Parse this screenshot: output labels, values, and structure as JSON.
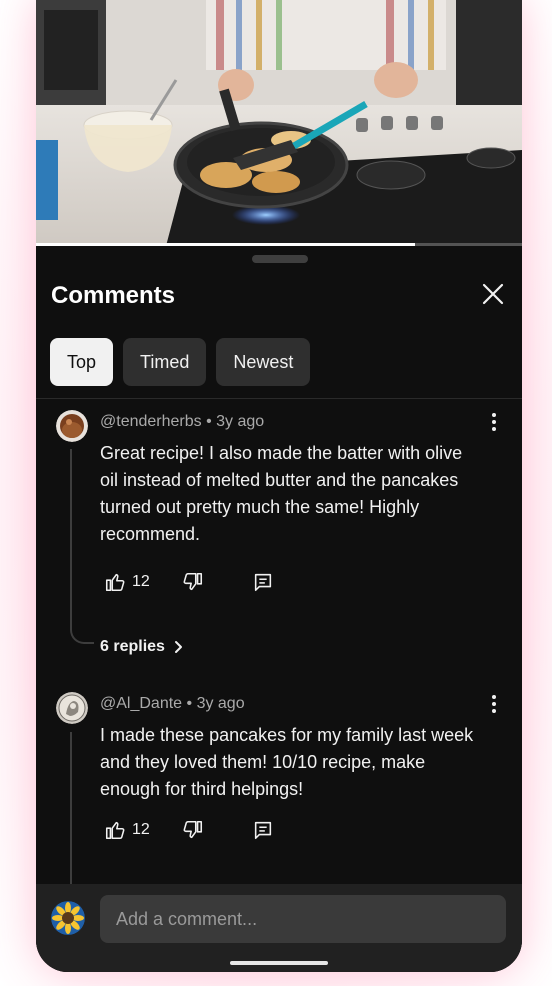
{
  "video": {
    "progress_fraction": 0.78
  },
  "panel": {
    "title": "Comments",
    "close_icon": "close-icon"
  },
  "tabs": [
    {
      "label": "Top",
      "active": true
    },
    {
      "label": "Timed",
      "active": false
    },
    {
      "label": "Newest",
      "active": false
    }
  ],
  "comments": [
    {
      "author": "@tenderherbs",
      "age": "3y ago",
      "text": "Great recipe! I also made the batter with olive oil instead of melted butter and the pancakes turned out pretty much the same! Highly recommend.",
      "likes": "12",
      "replies": "6 replies"
    },
    {
      "author": "@Al_Dante",
      "age": "3y ago",
      "text": "I made these pancakes for my family last week and they loved them! 10/10 recipe, make enough for third helpings!",
      "likes": "12"
    }
  ],
  "composer": {
    "placeholder": "Add a comment..."
  },
  "colors": {
    "background": "#0f0f0f",
    "chip_active": "#f1f1f1",
    "chip": "#2f2f2f",
    "composer": "#212121"
  }
}
